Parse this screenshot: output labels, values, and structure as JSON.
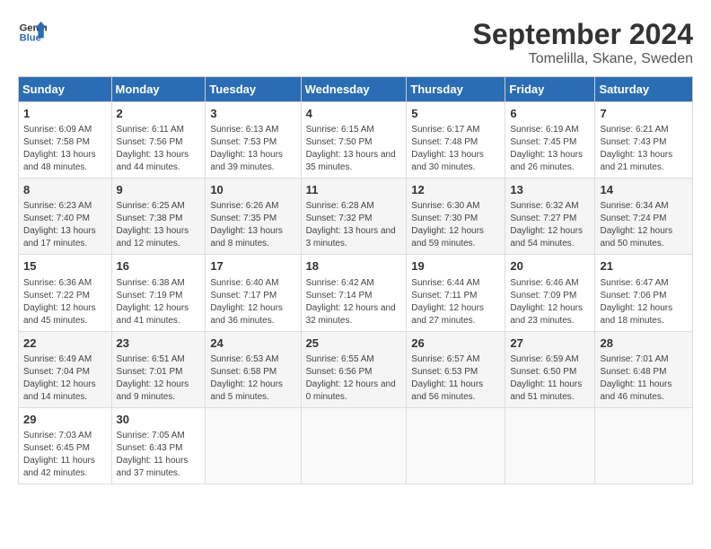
{
  "header": {
    "logo_line1": "General",
    "logo_line2": "Blue",
    "title": "September 2024",
    "subtitle": "Tomelilla, Skane, Sweden"
  },
  "calendar": {
    "days_of_week": [
      "Sunday",
      "Monday",
      "Tuesday",
      "Wednesday",
      "Thursday",
      "Friday",
      "Saturday"
    ],
    "weeks": [
      [
        {
          "day": "1",
          "info": "Sunrise: 6:09 AM\nSunset: 7:58 PM\nDaylight: 13 hours and 48 minutes."
        },
        {
          "day": "2",
          "info": "Sunrise: 6:11 AM\nSunset: 7:56 PM\nDaylight: 13 hours and 44 minutes."
        },
        {
          "day": "3",
          "info": "Sunrise: 6:13 AM\nSunset: 7:53 PM\nDaylight: 13 hours and 39 minutes."
        },
        {
          "day": "4",
          "info": "Sunrise: 6:15 AM\nSunset: 7:50 PM\nDaylight: 13 hours and 35 minutes."
        },
        {
          "day": "5",
          "info": "Sunrise: 6:17 AM\nSunset: 7:48 PM\nDaylight: 13 hours and 30 minutes."
        },
        {
          "day": "6",
          "info": "Sunrise: 6:19 AM\nSunset: 7:45 PM\nDaylight: 13 hours and 26 minutes."
        },
        {
          "day": "7",
          "info": "Sunrise: 6:21 AM\nSunset: 7:43 PM\nDaylight: 13 hours and 21 minutes."
        }
      ],
      [
        {
          "day": "8",
          "info": "Sunrise: 6:23 AM\nSunset: 7:40 PM\nDaylight: 13 hours and 17 minutes."
        },
        {
          "day": "9",
          "info": "Sunrise: 6:25 AM\nSunset: 7:38 PM\nDaylight: 13 hours and 12 minutes."
        },
        {
          "day": "10",
          "info": "Sunrise: 6:26 AM\nSunset: 7:35 PM\nDaylight: 13 hours and 8 minutes."
        },
        {
          "day": "11",
          "info": "Sunrise: 6:28 AM\nSunset: 7:32 PM\nDaylight: 13 hours and 3 minutes."
        },
        {
          "day": "12",
          "info": "Sunrise: 6:30 AM\nSunset: 7:30 PM\nDaylight: 12 hours and 59 minutes."
        },
        {
          "day": "13",
          "info": "Sunrise: 6:32 AM\nSunset: 7:27 PM\nDaylight: 12 hours and 54 minutes."
        },
        {
          "day": "14",
          "info": "Sunrise: 6:34 AM\nSunset: 7:24 PM\nDaylight: 12 hours and 50 minutes."
        }
      ],
      [
        {
          "day": "15",
          "info": "Sunrise: 6:36 AM\nSunset: 7:22 PM\nDaylight: 12 hours and 45 minutes."
        },
        {
          "day": "16",
          "info": "Sunrise: 6:38 AM\nSunset: 7:19 PM\nDaylight: 12 hours and 41 minutes."
        },
        {
          "day": "17",
          "info": "Sunrise: 6:40 AM\nSunset: 7:17 PM\nDaylight: 12 hours and 36 minutes."
        },
        {
          "day": "18",
          "info": "Sunrise: 6:42 AM\nSunset: 7:14 PM\nDaylight: 12 hours and 32 minutes."
        },
        {
          "day": "19",
          "info": "Sunrise: 6:44 AM\nSunset: 7:11 PM\nDaylight: 12 hours and 27 minutes."
        },
        {
          "day": "20",
          "info": "Sunrise: 6:46 AM\nSunset: 7:09 PM\nDaylight: 12 hours and 23 minutes."
        },
        {
          "day": "21",
          "info": "Sunrise: 6:47 AM\nSunset: 7:06 PM\nDaylight: 12 hours and 18 minutes."
        }
      ],
      [
        {
          "day": "22",
          "info": "Sunrise: 6:49 AM\nSunset: 7:04 PM\nDaylight: 12 hours and 14 minutes."
        },
        {
          "day": "23",
          "info": "Sunrise: 6:51 AM\nSunset: 7:01 PM\nDaylight: 12 hours and 9 minutes."
        },
        {
          "day": "24",
          "info": "Sunrise: 6:53 AM\nSunset: 6:58 PM\nDaylight: 12 hours and 5 minutes."
        },
        {
          "day": "25",
          "info": "Sunrise: 6:55 AM\nSunset: 6:56 PM\nDaylight: 12 hours and 0 minutes."
        },
        {
          "day": "26",
          "info": "Sunrise: 6:57 AM\nSunset: 6:53 PM\nDaylight: 11 hours and 56 minutes."
        },
        {
          "day": "27",
          "info": "Sunrise: 6:59 AM\nSunset: 6:50 PM\nDaylight: 11 hours and 51 minutes."
        },
        {
          "day": "28",
          "info": "Sunrise: 7:01 AM\nSunset: 6:48 PM\nDaylight: 11 hours and 46 minutes."
        }
      ],
      [
        {
          "day": "29",
          "info": "Sunrise: 7:03 AM\nSunset: 6:45 PM\nDaylight: 11 hours and 42 minutes."
        },
        {
          "day": "30",
          "info": "Sunrise: 7:05 AM\nSunset: 6:43 PM\nDaylight: 11 hours and 37 minutes."
        },
        {
          "day": "",
          "info": ""
        },
        {
          "day": "",
          "info": ""
        },
        {
          "day": "",
          "info": ""
        },
        {
          "day": "",
          "info": ""
        },
        {
          "day": "",
          "info": ""
        }
      ]
    ]
  }
}
